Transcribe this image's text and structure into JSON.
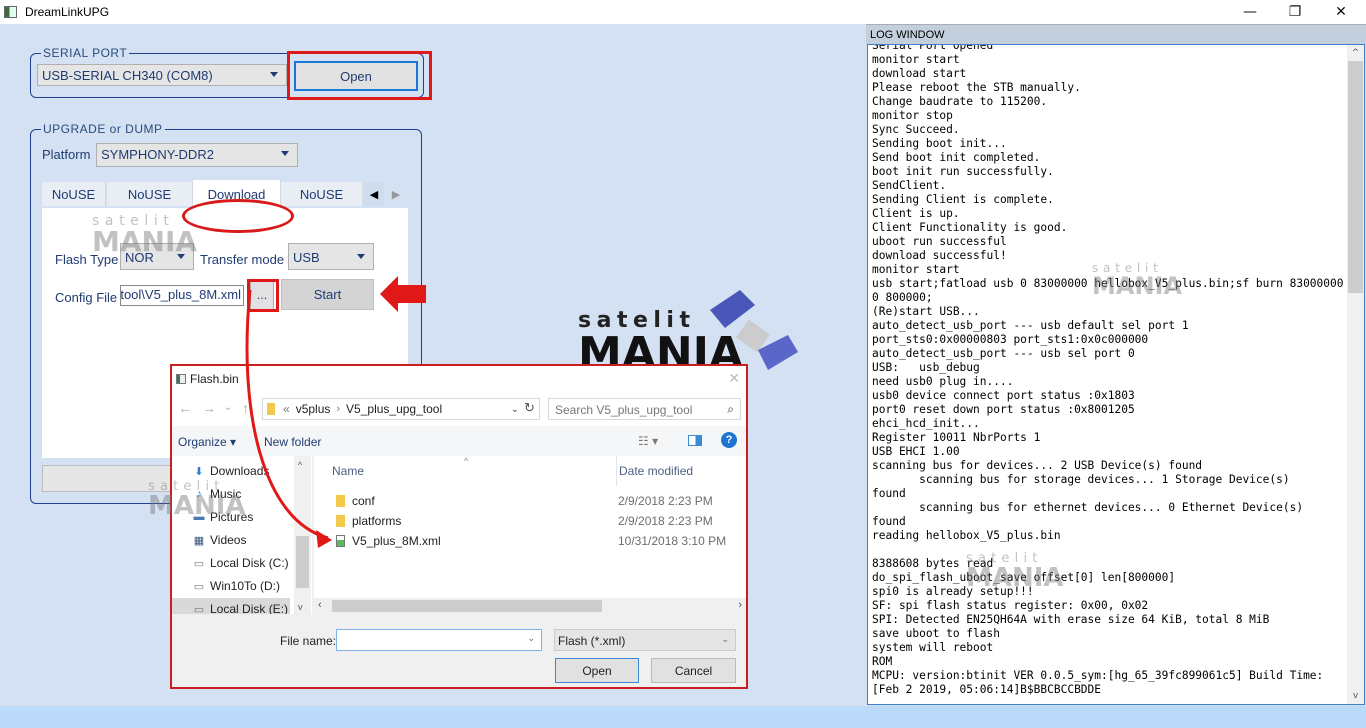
{
  "window": {
    "title": "DreamLinkUPG",
    "controls": {
      "minimize": "—",
      "maximize": "❐",
      "close": "✕"
    }
  },
  "serial_port": {
    "legend": "SERIAL PORT",
    "selected_port": "USB-SERIAL CH340 (COM8)",
    "open_label": "Open"
  },
  "upgrade": {
    "legend": "UPGRADE or DUMP",
    "platform_label": "Platform",
    "platform_value": "SYMPHONY-DDR2",
    "tabs": [
      {
        "label": "NoUSE"
      },
      {
        "label": "NoUSE"
      },
      {
        "label": "Download",
        "active": true
      },
      {
        "label": "NoUSE"
      }
    ],
    "tab_scroll_left": "◀",
    "tab_scroll_right": "▶",
    "flash_type_label": "Flash Type",
    "flash_type_value": "NOR",
    "transfer_mode_label": "Transfer mode",
    "transfer_mode_value": "USB",
    "config_file_label": "Config File",
    "config_file_value": "tool\\V5_plus_8M.xml",
    "browse_label": "...",
    "start_label": "Start"
  },
  "log": {
    "header": "LOG WINDOW",
    "lines": [
      "Serial Port Opened",
      "monitor start",
      "download start",
      "Please reboot the STB manually.",
      "Change baudrate to 115200.",
      "monitor stop",
      "Sync Succeed.",
      "Sending boot init...",
      "Send boot init completed.",
      "boot init run successfully.",
      "SendClient.",
      "Sending Client is complete.",
      "Client is up.",
      "Client Functionality is good.",
      "uboot run successful",
      "download successful!",
      "monitor start",
      "usb start;fatload usb 0 83000000 hellobox_V5_plus.bin;sf burn 83000000",
      "0 800000;",
      "(Re)start USB...",
      "auto_detect_usb_port --- usb default sel port 1",
      "port_sts0:0x00000803 port_sts1:0x0c000000",
      "auto_detect_usb_port --- usb sel port 0",
      "USB:   usb_debug",
      "need usb0 plug in....",
      "usb0 device connect port status :0x1803",
      "port0 reset down port status :0x8001205",
      "ehci_hcd_init...",
      "Register 10011 NbrPorts 1",
      "USB EHCI 1.00",
      "scanning bus for devices... 2 USB Device(s) found",
      "       scanning bus for storage devices... 1 Storage Device(s)",
      "found",
      "       scanning bus for ethernet devices... 0 Ethernet Device(s)",
      "found",
      "reading hellobox_V5_plus.bin",
      "",
      "8388608 bytes read",
      "do_spi_flash_uboot_save offset[0] len[800000]",
      "spi0 is already setup!!!",
      "SF: spi flash status register: 0x00, 0x02",
      "SPI: Detected EN25QH64A with erase size 64 KiB, total 8 MiB",
      "save uboot to flash",
      "system will reboot",
      "ROM",
      "MCPU: version:btinit VER 0.0.5_sym:[hg_65_39fc899061c5] Build Time:",
      "[Feb 2 2019, 05:06:14]B$BBCBCCBDDE"
    ],
    "scroll_up": "^",
    "scroll_down": "v"
  },
  "file_dialog": {
    "title": "Flash.bin",
    "nav": {
      "back": "←",
      "forward": "→",
      "recent": "⌄",
      "up": "↑"
    },
    "path": [
      "«",
      "v5plus",
      "V5_plus_upg_tool"
    ],
    "path_sep": "›",
    "refresh": "↻",
    "search_placeholder": "Search V5_plus_upg_tool",
    "organize_label": "Organize ▾",
    "new_folder_label": "New folder",
    "view_label": "☷ ▾",
    "help_label": "?",
    "sidebar": [
      {
        "label": "Downloads",
        "icon": "⬇"
      },
      {
        "label": "Music",
        "icon": "♪"
      },
      {
        "label": "Pictures",
        "icon": "▬"
      },
      {
        "label": "Videos",
        "icon": "▦"
      },
      {
        "label": "Local Disk (C:)",
        "icon": "▭"
      },
      {
        "label": "Win10To (D:)",
        "icon": "▭"
      },
      {
        "label": "Local Disk (E:)",
        "icon": "▭",
        "selected": true
      }
    ],
    "columns": {
      "name": "Name",
      "date": "Date modified"
    },
    "files": [
      {
        "name": "conf",
        "type": "folder",
        "date": "2/9/2018 2:23 PM"
      },
      {
        "name": "platforms",
        "type": "folder",
        "date": "2/9/2018 2:23 PM"
      },
      {
        "name": "V5_plus_8M.xml",
        "type": "xml",
        "date": "10/31/2018 3:10 PM"
      }
    ],
    "file_name_label": "File name:",
    "file_name_value": "",
    "filter_value": "Flash (*.xml)",
    "open_label": "Open",
    "cancel_label": "Cancel"
  },
  "watermark": {
    "top": "satelit",
    "bottom": "MANIA"
  },
  "colors": {
    "accent": "#1976d2",
    "annotation": "#e01818",
    "panel_bg": "#d3e1f2",
    "text": "#1f3b73"
  }
}
